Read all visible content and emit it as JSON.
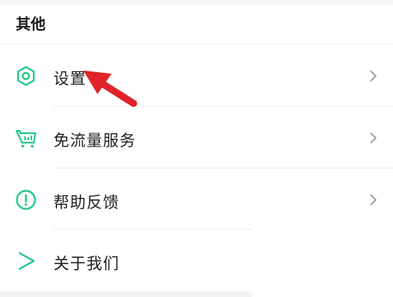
{
  "section": {
    "title": "其他"
  },
  "menu": {
    "items": [
      {
        "label": "设置",
        "icon": "gear-hexagon-icon"
      },
      {
        "label": "免流量服务",
        "icon": "cart-chart-icon"
      },
      {
        "label": "帮助反馈",
        "icon": "exclamation-circle-icon"
      },
      {
        "label": "关于我们",
        "icon": "play-triangle-icon"
      }
    ]
  },
  "colors": {
    "accent": "#2bc98a",
    "annotation": "#e0232a",
    "chevron": "#9a9a9a"
  }
}
